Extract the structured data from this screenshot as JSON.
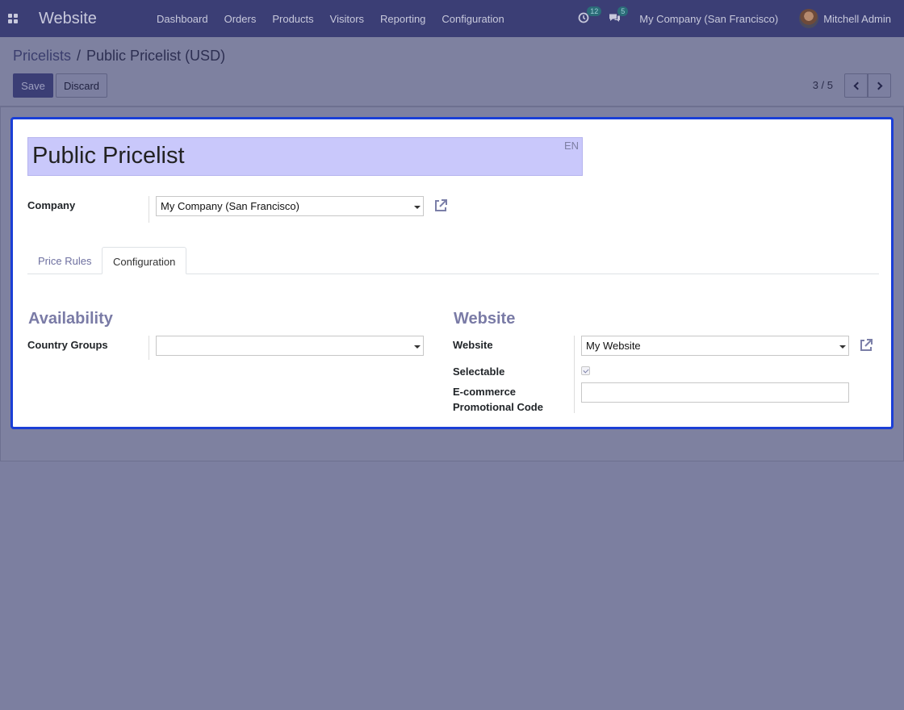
{
  "navbar": {
    "app_name": "Website",
    "menu": [
      "Dashboard",
      "Orders",
      "Products",
      "Visitors",
      "Reporting",
      "Configuration"
    ],
    "activity_count": "12",
    "message_count": "5",
    "company": "My Company (San Francisco)",
    "user": "Mitchell Admin"
  },
  "breadcrumb": {
    "parent": "Pricelists",
    "separator": "/",
    "current": "Public Pricelist (USD)"
  },
  "buttons": {
    "save": "Save",
    "discard": "Discard"
  },
  "pager": {
    "value": "3 / 5"
  },
  "form": {
    "name": "Public Pricelist",
    "lang": "EN",
    "company_label": "Company",
    "company_value": "My Company (San Francisco)",
    "tabs": [
      "Price Rules",
      "Configuration"
    ],
    "active_tab": "Configuration",
    "availability": {
      "title": "Availability",
      "country_groups_label": "Country Groups",
      "country_groups_value": ""
    },
    "website": {
      "title": "Website",
      "website_label": "Website",
      "website_value": "My Website",
      "selectable_label": "Selectable",
      "selectable_checked": true,
      "promo_label_line1": "E-commerce",
      "promo_label_line2": "Promotional Code",
      "promo_value": ""
    }
  },
  "colors": {
    "navbar": "#3b3e75",
    "title_highlight": "#c9c8fb",
    "focus_border": "#1a3fd6",
    "section_title": "#7a7ba6"
  }
}
